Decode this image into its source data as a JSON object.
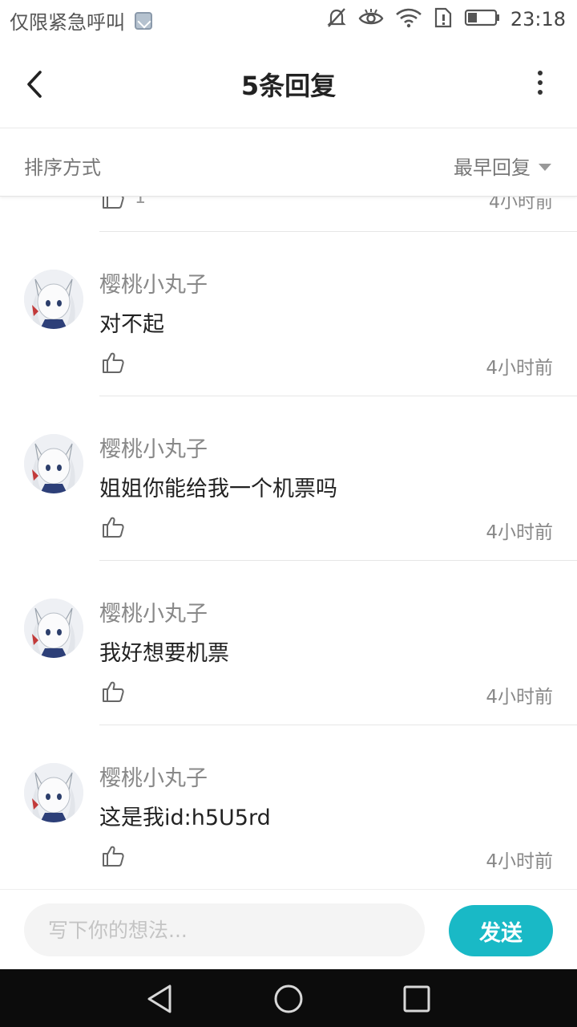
{
  "status_bar": {
    "carrier_text": "仅限紧急呼叫",
    "time": "23:18",
    "battery_level": 0.35,
    "icons": [
      "image-notification-icon",
      "mute-icon",
      "eye-icon",
      "wifi-icon",
      "sim-alert-icon",
      "battery-icon"
    ]
  },
  "header": {
    "title": "5条回复",
    "back_icon": "chevron-left-icon",
    "more_icon": "more-vertical-icon"
  },
  "sort": {
    "label": "排序方式",
    "selected": "最早回复"
  },
  "partial_reply": {
    "like_count": "1",
    "time": "4小时前"
  },
  "replies": [
    {
      "username": "樱桃小丸子",
      "text": "对不起",
      "time": "4小时前"
    },
    {
      "username": "樱桃小丸子",
      "text": "姐姐你能给我一个机票吗",
      "time": "4小时前"
    },
    {
      "username": "樱桃小丸子",
      "text": "我好想要机票",
      "time": "4小时前"
    },
    {
      "username": "樱桃小丸子",
      "text": "这是我id:h5U5rd",
      "time": "4小时前"
    }
  ],
  "composer": {
    "placeholder": "写下你的想法...",
    "send_label": "发送"
  },
  "colors": {
    "accent": "#19b9c6",
    "nav_bar": "#0c0c0c",
    "muted_text": "#888888"
  }
}
